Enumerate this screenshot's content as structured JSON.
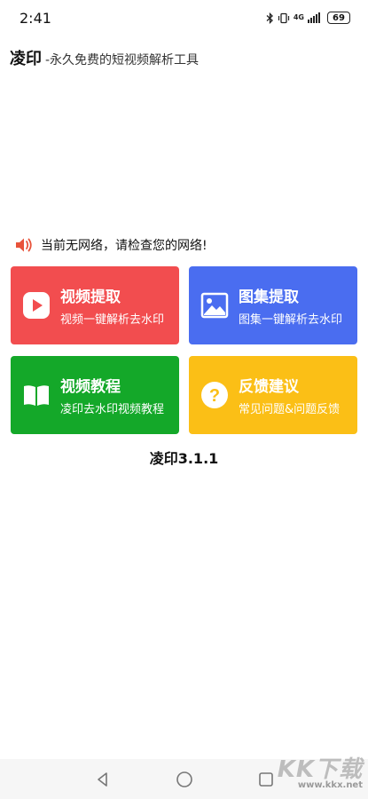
{
  "status_bar": {
    "time": "2:41",
    "network": "4G",
    "battery": "69"
  },
  "header": {
    "app_name": "凌印",
    "slogan": "-永久免费的短视频解析工具"
  },
  "notice": {
    "icon": "speaker-icon",
    "text": "当前无网络，请检查您的网络!",
    "color": "#e8533a"
  },
  "cards": {
    "video_extract": {
      "title": "视频提取",
      "subtitle": "视频一键解析去水印",
      "color": "#f24d4f",
      "icon": "play-icon"
    },
    "gallery_extract": {
      "title": "图集提取",
      "subtitle": "图集一键解析去水印",
      "color": "#4a6df0",
      "icon": "image-icon"
    },
    "video_tutorial": {
      "title": "视频教程",
      "subtitle": "凌印去水印视频教程",
      "color": "#14a829",
      "icon": "book-icon"
    },
    "feedback": {
      "title": "反馈建议",
      "subtitle": "常见问题&问题反馈",
      "color": "#fbbf16",
      "icon": "question-icon"
    }
  },
  "version": "凌印3.1.1",
  "nav": {
    "back": "back-icon",
    "home": "home-icon",
    "recents": "recents-icon"
  },
  "watermark": {
    "logo": "KK下载",
    "url": "www.kkx.net"
  }
}
